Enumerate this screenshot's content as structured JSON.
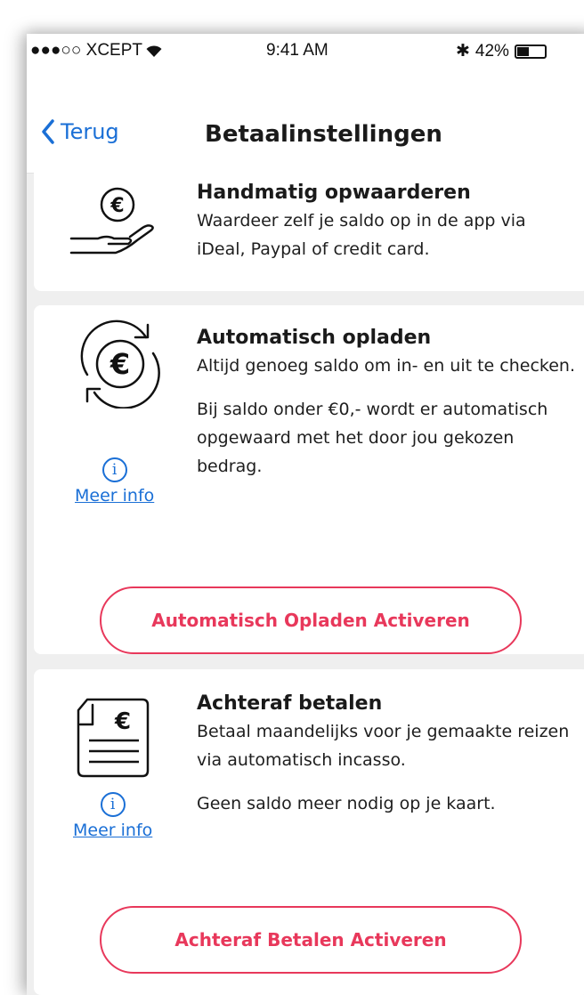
{
  "status_bar": {
    "carrier": "●●●○○ XCEPT",
    "time": "9:41 AM",
    "bluetooth": "✱",
    "battery_percent": "42%",
    "battery_level": 0.42
  },
  "nav": {
    "back_label": "Terug",
    "title": "Betaalinstellingen"
  },
  "cards": {
    "manual": {
      "title": "Handmatig opwaarderen",
      "description": "Waardeer zelf je saldo op in de app via iDeal, Paypal of credit card.",
      "icon": "hand-euro-coin-icon"
    },
    "auto": {
      "title": "Automatisch opladen",
      "description": "Altijd genoeg saldo om in- en uit te checken.",
      "description_extra": "Bij saldo onder €0,- wordt er automatisch opgewaard met het door jou gekozen bedrag.",
      "info_icon": "i",
      "info_link": "Meer info",
      "button_label": "Automatisch Opladen Activeren",
      "icon": "euro-refresh-icon"
    },
    "afterpay": {
      "title": "Achteraf betalen",
      "description": "Betaal maandelijks voor je gemaakte reizen via automatisch incasso.",
      "description_extra": "Geen saldo meer nodig op je kaart.",
      "info_icon": "i",
      "info_link": "Meer info",
      "button_label": "Achteraf Betalen Activeren",
      "icon": "euro-invoice-icon"
    }
  },
  "colors": {
    "accent_link": "#1a6fd6",
    "accent_button": "#e8385b",
    "background": "#efefef"
  }
}
